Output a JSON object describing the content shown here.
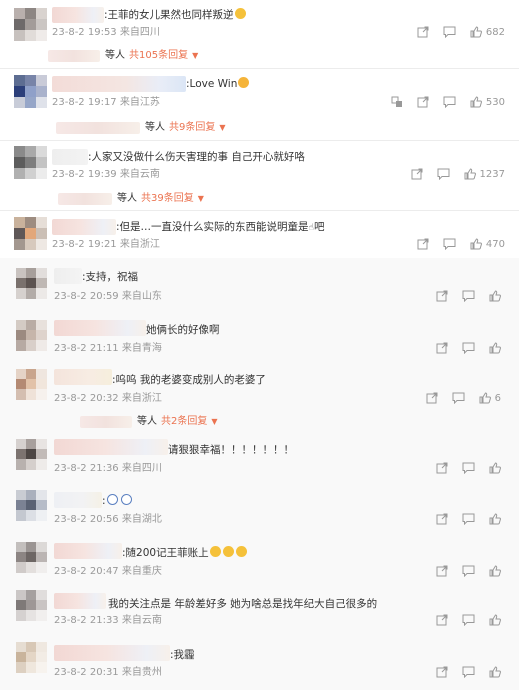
{
  "comments": [
    {
      "text": ":王菲的女儿果然也同样叛逆",
      "date": "23-8-2 19:53",
      "location": "来自四川",
      "likes": "682",
      "replies": "共105条回复"
    },
    {
      "text": ":Love Win",
      "date": "23-8-2 19:17",
      "location": "来自江苏",
      "likes": "530",
      "replies": "共9条回复"
    },
    {
      "text": ":人家又没做什么伤天害理的事 自己开心就好咯",
      "date": "23-8-2 19:39",
      "location": "来自云南",
      "likes": "1237",
      "replies": "共39条回复"
    },
    {
      "text": ":但是…一直没什么实际的东西能说明童是",
      "text_suffix": "吧",
      "date": "23-8-2 19:21",
      "location": "来自浙江",
      "likes": "470"
    },
    {
      "text": ":支持，祝福",
      "date": "23-8-2 20:59",
      "location": "来自山东"
    },
    {
      "text": "她俩长的好像啊",
      "date": "23-8-2 21:11",
      "location": "来自青海"
    },
    {
      "text": ":呜呜 我的老婆变成别人的老婆了",
      "date": "23-8-2 20:32",
      "location": "来自浙江",
      "likes": "6",
      "replies": "共2条回复"
    },
    {
      "text": "请狠狠幸福！！！！！！！",
      "date": "23-8-2 21:36",
      "location": "来自四川"
    },
    {
      "text": ":",
      "date": "23-8-2 20:56",
      "location": "来自湖北"
    },
    {
      "text": ":随200记王菲账上",
      "date": "23-8-2 20:47",
      "location": "来自重庆"
    },
    {
      "text": "我的关注点是 年龄差好多 她为啥总是找年纪大自己很多的",
      "date": "23-8-2 21:33",
      "location": "来自云南"
    },
    {
      "text": ":我霾",
      "date": "23-8-2 20:31",
      "location": "来自贵州"
    }
  ],
  "reply_prefix": "等人",
  "icons": [
    "share-icon",
    "comment-icon",
    "like-icon",
    "translate-icon",
    "emoji-icon",
    "dropdown-caret-icon"
  ],
  "colors": {
    "accent": "#eb7350",
    "meta": "#999999",
    "text": "#333333"
  }
}
